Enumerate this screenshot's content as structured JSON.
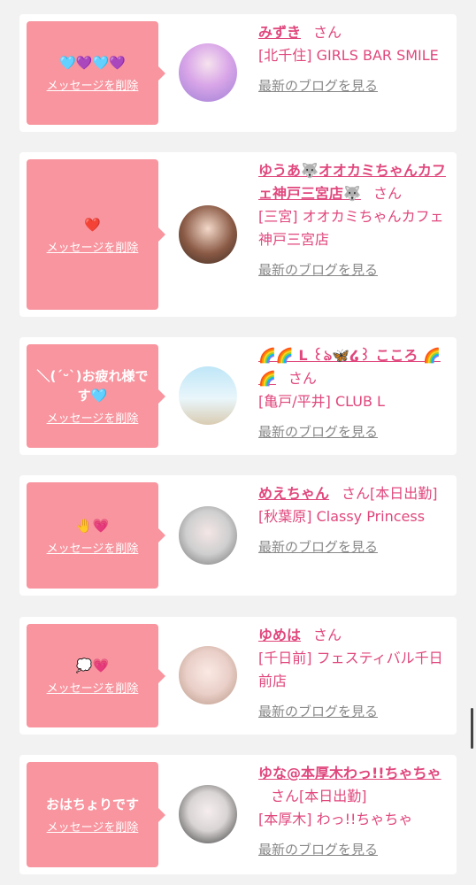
{
  "delete_label": "メッセージを削除",
  "blog_label": "最新のブログを見る",
  "san": "さん",
  "accent_color": "#e0477d",
  "bubble_color": "#f8959f",
  "cards": [
    {
      "message": "🩵💜🩵💜",
      "name": "みずき",
      "suffix": "",
      "shop": "[北千住] GIRLS BAR SMILE"
    },
    {
      "message": "❤️",
      "name": "ゆうあ🐺オオカミちゃんカフェ神戸三宮店🐺",
      "suffix": "",
      "shop": "[三宮] オオカミちゃんカフェ神戸三宮店"
    },
    {
      "message": "＼(ˊᵕˋ)お疲れ様です🩵",
      "name": "🌈🌈 L ꒰ঌ🦋໒꒱ こころ 🌈🌈",
      "suffix": "",
      "shop": "[亀戸/平井] CLUB L"
    },
    {
      "message": "🤚💗",
      "name": "めえちゃん",
      "suffix": "[本日出勤]",
      "shop": "[秋葉原] Classy Princess"
    },
    {
      "message": "💭💗",
      "name": "ゆめは",
      "suffix": "",
      "shop": "[千日前] フェスティバル千日前店"
    },
    {
      "message": "おはちょりです",
      "name": "ゆな@本厚木わっ!!ちゃちゃ",
      "suffix": "[本日出勤]",
      "shop": "[本厚木] わっ!!ちゃちゃ"
    }
  ]
}
